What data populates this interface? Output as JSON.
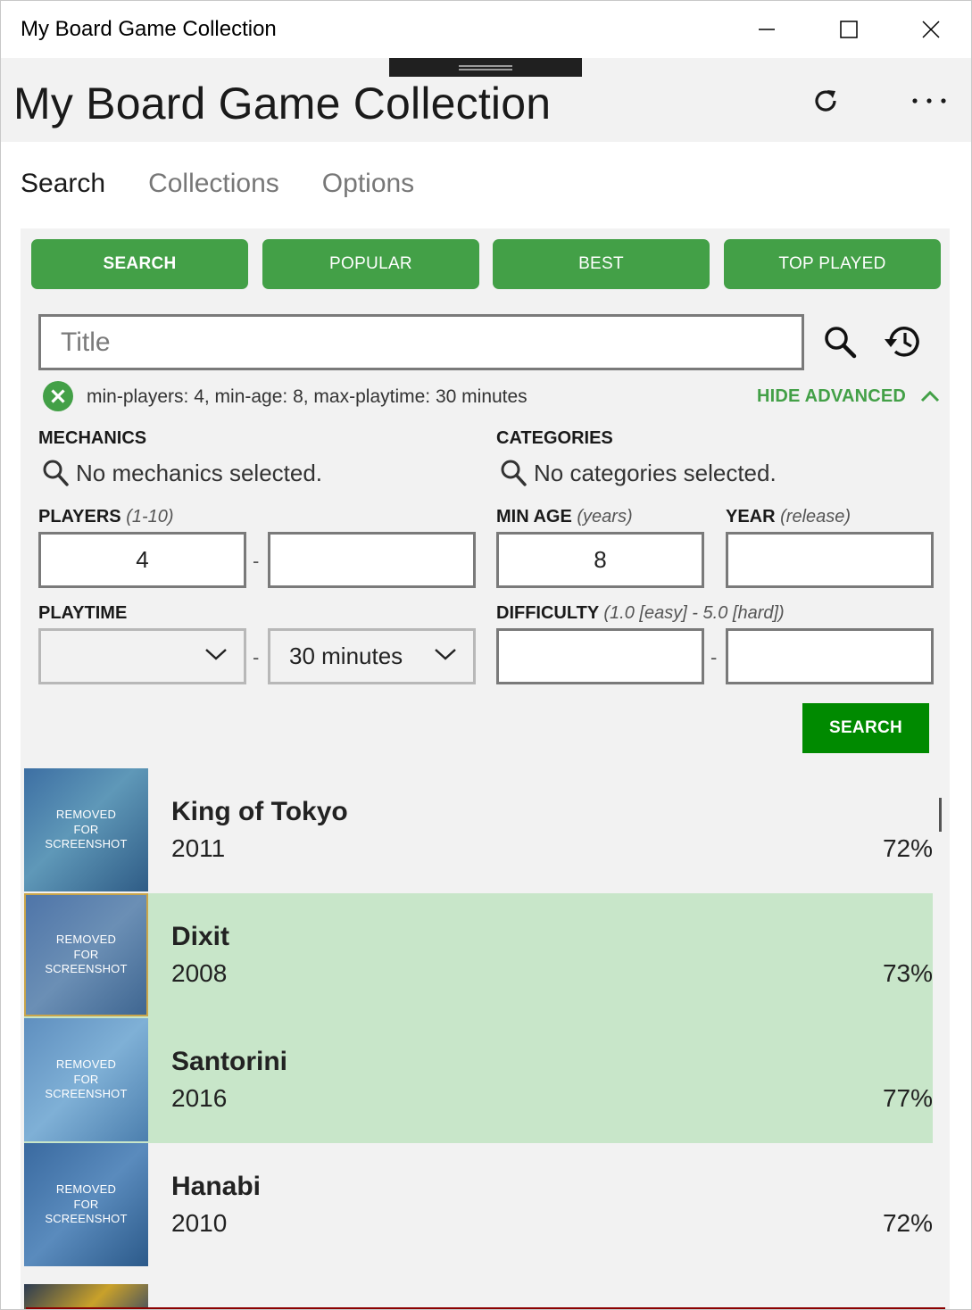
{
  "window": {
    "title": "My Board Game Collection"
  },
  "header": {
    "title": "My Board Game Collection",
    "refresh_icon": "refresh-icon",
    "more_icon": "more-icon"
  },
  "tabs": [
    {
      "label": "Search",
      "active": true
    },
    {
      "label": "Collections",
      "active": false
    },
    {
      "label": "Options",
      "active": false
    }
  ],
  "quick_buttons": [
    {
      "label": "SEARCH"
    },
    {
      "label": "POPULAR"
    },
    {
      "label": "BEST"
    },
    {
      "label": "TOP PLAYED"
    }
  ],
  "search": {
    "placeholder": "Title",
    "value": "",
    "filter_summary": "min-players: 4, min-age: 8, max-playtime: 30 minutes",
    "hide_advanced": "HIDE ADVANCED"
  },
  "advanced": {
    "mechanics": {
      "label": "MECHANICS",
      "empty": "No mechanics selected."
    },
    "categories": {
      "label": "CATEGORIES",
      "empty": "No categories selected."
    },
    "players": {
      "label": "PLAYERS",
      "hint": "(1-10)",
      "min": "4",
      "max": ""
    },
    "min_age": {
      "label": "MIN AGE",
      "hint": "(years)",
      "value": "8"
    },
    "year": {
      "label": "YEAR",
      "hint": "(release)",
      "value": ""
    },
    "playtime": {
      "label": "PLAYTIME",
      "min": "",
      "max": "30 minutes"
    },
    "difficulty": {
      "label": "DIFFICULTY",
      "hint": "(1.0 [easy] - 5.0 [hard])",
      "min": "",
      "max": ""
    },
    "range_separator": "-",
    "search_button": "SEARCH"
  },
  "thumbnail_text": "REMOVED FOR SCREENSHOT",
  "results": [
    {
      "name": "King of Tokyo",
      "year": "2011",
      "rating": "72%",
      "selected": false
    },
    {
      "name": "Dixit",
      "year": "2008",
      "rating": "73%",
      "selected": true
    },
    {
      "name": "Santorini",
      "year": "2016",
      "rating": "77%",
      "selected": true
    },
    {
      "name": "Hanabi",
      "year": "2010",
      "rating": "72%",
      "selected": false
    }
  ],
  "colors": {
    "accent_green": "#43a047",
    "search_green": "#008a00",
    "selected_row": "#c8e6c9",
    "panel_bg": "#f2f2f2"
  }
}
